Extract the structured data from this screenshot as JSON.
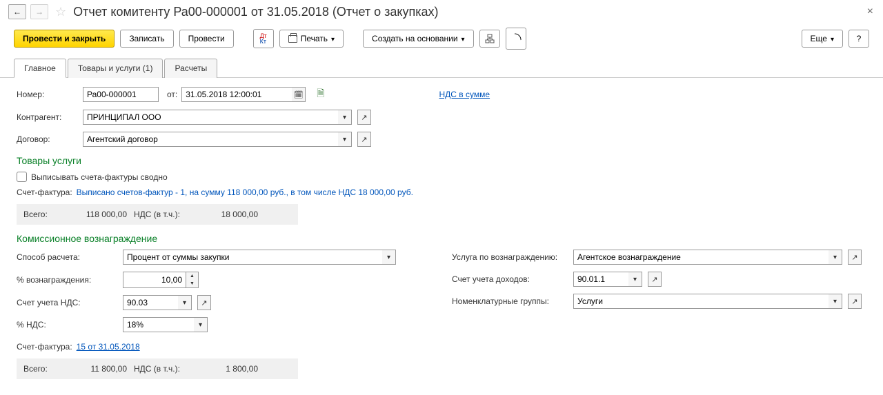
{
  "header": {
    "title": "Отчет комитенту Ра00-000001 от 31.05.2018 (Отчет о закупках)"
  },
  "toolbar": {
    "post_close": "Провести и закрыть",
    "save": "Записать",
    "post": "Провести",
    "print": "Печать",
    "create_basis": "Создать на основании",
    "more": "Еще",
    "help": "?"
  },
  "tabs": {
    "main": "Главное",
    "goods": "Товары и услуги (1)",
    "calc": "Расчеты"
  },
  "main": {
    "number_label": "Номер:",
    "number": "Ра00-000001",
    "from_label": "от:",
    "date": "31.05.2018 12:00:01",
    "vat_link": "НДС в сумме",
    "counterparty_label": "Контрагент:",
    "counterparty": "ПРИНЦИПАЛ ООО",
    "contract_label": "Договор:",
    "contract": "Агентский договор"
  },
  "goods": {
    "section": "Товары услуги",
    "checkbox_label": "Выписывать счета-фактуры сводно",
    "invoice_label": "Счет-фактура:",
    "invoice_text": "Выписано счетов-фактур - 1, на сумму 118 000,00 руб., в том числе НДС 18 000,00 руб.",
    "total_label": "Всего:",
    "total_value": "118 000,00",
    "vat_label": "НДС (в т.ч.):",
    "vat_value": "18 000,00"
  },
  "commission": {
    "section": "Комиссионное вознаграждение",
    "calc_method_label": "Способ расчета:",
    "calc_method": "Процент от суммы закупки",
    "percent_label": "% вознаграждения:",
    "percent_value": "10,00",
    "vat_account_label": "Счет учета НДС:",
    "vat_account": "90.03",
    "vat_percent_label": "% НДС:",
    "vat_percent": "18%",
    "service_label": "Услуга по вознаграждению:",
    "service": "Агентское вознаграждение",
    "income_account_label": "Счет учета доходов:",
    "income_account": "90.01.1",
    "nomenclature_label": "Номенклатурные группы:",
    "nomenclature": "Услуги",
    "invoice_label": "Счет-фактура:",
    "invoice_link": "15 от 31.05.2018",
    "total_label": "Всего:",
    "total_value": "11 800,00",
    "vat_label": "НДС (в т.ч.):",
    "vat_value": "1 800,00"
  }
}
